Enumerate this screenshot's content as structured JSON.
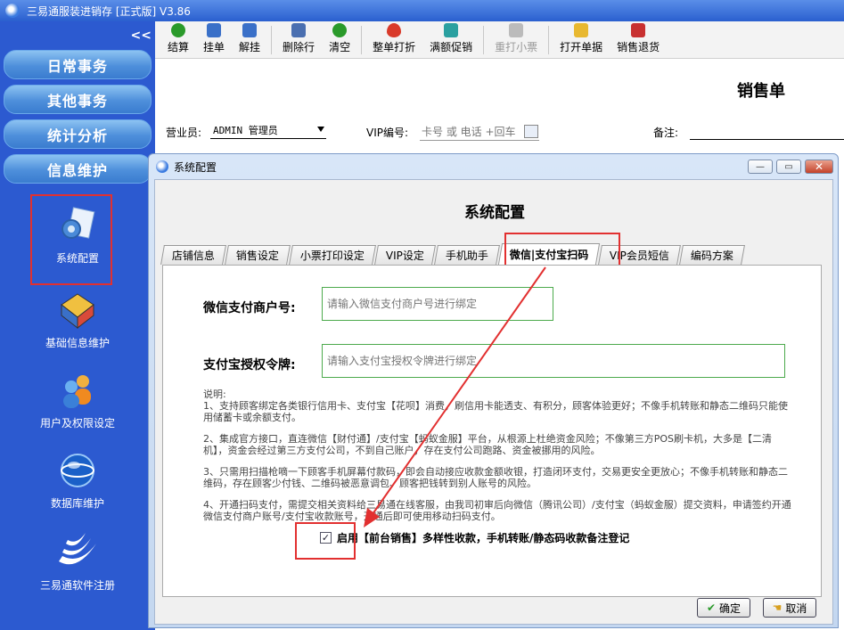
{
  "app": {
    "title": "三易通服装进销存 [正式版] V3.86"
  },
  "sidebar": {
    "collapse_symbol": "<<",
    "nav_buttons": [
      "日常事务",
      "其他事务",
      "统计分析",
      "信息维护"
    ],
    "items": [
      {
        "label": "系统配置",
        "icon": "gear-document-icon"
      },
      {
        "label": "基础信息维护",
        "icon": "cubes-icon"
      },
      {
        "label": "用户及权限设定",
        "icon": "users-icon"
      },
      {
        "label": "数据库维护",
        "icon": "globe-icon"
      },
      {
        "label": "三易通软件注册",
        "icon": "swoosh-logo-icon"
      }
    ]
  },
  "toolbar": {
    "buttons": [
      {
        "label": "结算",
        "icon": "check-icon",
        "color": "#2a9a2a",
        "disabled": false
      },
      {
        "label": "挂单",
        "icon": "hang-order-icon",
        "color": "#3a70c8",
        "disabled": false
      },
      {
        "label": "解挂",
        "icon": "unhang-icon",
        "color": "#3a70c8",
        "disabled": false
      },
      {
        "label": "删除行",
        "icon": "delete-row-icon",
        "color": "#4a6fb0",
        "disabled": false
      },
      {
        "label": "清空",
        "icon": "refresh-icon",
        "color": "#2a9a2a",
        "disabled": false
      },
      {
        "label": "整单打折",
        "icon": "strawberry-icon",
        "color": "#d93a2a",
        "disabled": false
      },
      {
        "label": "满额促销",
        "icon": "gift-icon",
        "color": "#2aa0a0",
        "disabled": false
      },
      {
        "label": "重打小票",
        "icon": "printer-icon",
        "color": "#aaaaaa",
        "disabled": true
      },
      {
        "label": "打开单据",
        "icon": "folder-icon",
        "color": "#e8b830",
        "disabled": false
      },
      {
        "label": "销售退货",
        "icon": "return-icon",
        "color": "#c83030",
        "disabled": false
      }
    ]
  },
  "sales": {
    "title": "销售单",
    "salesman_label": "营业员:",
    "salesman_value": "ADMIN 管理员",
    "vip_label": "VIP编号:",
    "vip_placeholder": "卡号 或 电话 +回车",
    "remark_label": "备注:"
  },
  "dialog": {
    "title": "系统配置",
    "heading": "系统配置",
    "window_buttons": {
      "minimize": "—",
      "maximize": "▭",
      "close": "✕"
    },
    "tabs": [
      "店铺信息",
      "销售设定",
      "小票打印设定",
      "VIP设定",
      "手机助手",
      "微信|支付宝扫码",
      "VIP会员短信",
      "编码方案"
    ],
    "active_tab": 5,
    "wechat_label": "微信支付商户号:",
    "wechat_placeholder": "请输入微信支付商户号进行绑定",
    "alipay_label": "支付宝授权令牌:",
    "alipay_placeholder": "请输入支付宝授权令牌进行绑定",
    "explain": [
      "说明:",
      "1、支持顾客绑定各类银行信用卡、支付宝【花呗】消费，刷信用卡能透支、有积分，顾客体验更好；不像手机转账和静态二维码只能使用储蓄卡或余额支付。",
      "2、集成官方接口，直连微信【财付通】/支付宝【蚂蚁金服】平台，从根源上杜绝资金风险；不像第三方POS刷卡机，大多是【二清机】，资金会经过第三方支付公司，不到自己账户，存在支付公司跑路、资金被挪用的风险。",
      "3、只需用扫描枪嘀一下顾客手机屏幕付款码，即会自动接应收款金额收银，打造闭环支付，交易更安全更放心；不像手机转账和静态二维码，存在顾客少付钱、二维码被恶意调包、顾客把钱转到别人账号的风险。",
      "4、开通扫码支付，需提交相关资料给三易通在线客服，由我司初审后向微信（腾讯公司）/支付宝（蚂蚁金服）提交资料，申请签约开通微信支付商户账号/支付宝收款账号，开通后即可使用移动扫码支付。"
    ],
    "enable_label": "启用【前台销售】多样性收款，手机转账/静态码收款备注登记",
    "enable_checked": true,
    "ok_label": "确定",
    "cancel_label": "取消"
  },
  "colors": {
    "annotation": "#e23030",
    "sidebar": "#2c5ad0",
    "input_border": "#4caa4c"
  }
}
